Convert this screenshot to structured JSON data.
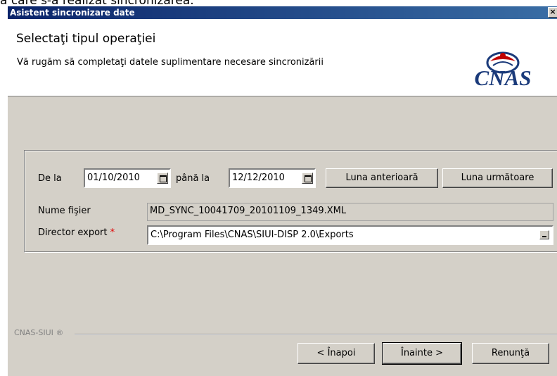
{
  "background_text": "a care s-a realizat sincronizarea.",
  "window": {
    "title": "Asistent sincronizare date",
    "close_glyph": "×"
  },
  "header": {
    "title": "Selectaţi tipul operaţiei",
    "subtitle": "Vă rugăm să completaţi datele suplimentare necesare sincronizării",
    "logo_text": "CNAS"
  },
  "form": {
    "from_label": "De la",
    "from_date": "01/10/2010",
    "to_label": "până la",
    "to_date": "12/12/2010",
    "prev_month_button": "Luna anterioară",
    "next_month_button": "Luna următoare",
    "filename_label": "Nume fişier",
    "filename_value": "MD_SYNC_10041709_20101109_1349.XML",
    "export_dir_label": "Director export",
    "required_mark": "*",
    "export_dir_value": "C:\\Program Files\\CNAS\\SIUI-DISP 2.0\\Exports"
  },
  "footer": {
    "brand": "CNAS-SIUI ®",
    "back_button": "Înapoi",
    "back_prefix": "< ",
    "next_button": "Înainte",
    "next_suffix": " >",
    "cancel_button": "Renunţă"
  },
  "colors": {
    "titlebar": "#0a246a",
    "dialog_face": "#d4d0c8",
    "required": "#e00000",
    "logo": "#1a3a7a"
  }
}
